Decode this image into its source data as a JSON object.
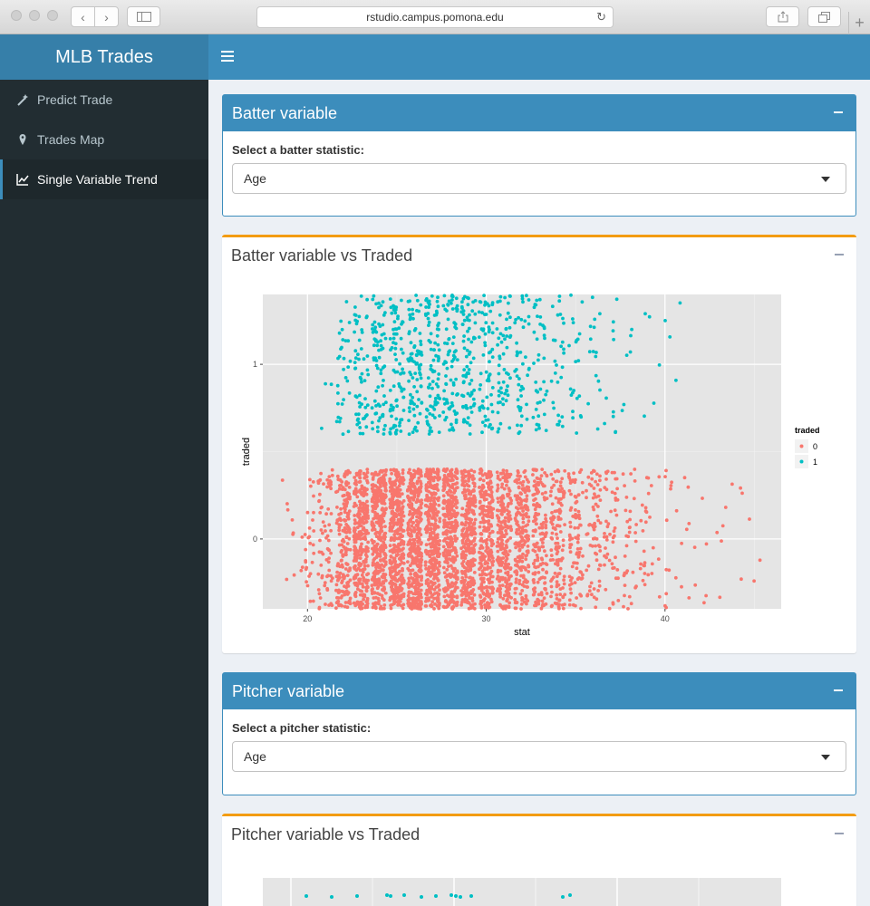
{
  "browser": {
    "url": "rstudio.campus.pomona.edu"
  },
  "app": {
    "title": "MLB Trades"
  },
  "colors": {
    "header": "#3c8dbc",
    "logo_bg": "#367fa9",
    "sidebar_bg": "#222d32",
    "warning": "#f39c12",
    "traded_0": "#f8766d",
    "traded_1": "#00bfc4"
  },
  "sidebar": {
    "items": [
      {
        "label": "Predict Trade",
        "icon": "magic-wand-icon",
        "active": false
      },
      {
        "label": "Trades Map",
        "icon": "map-marker-icon",
        "active": false
      },
      {
        "label": "Single Variable Trend",
        "icon": "line-chart-icon",
        "active": true
      }
    ]
  },
  "batter_box": {
    "title": "Batter variable",
    "label": "Select a batter statistic:",
    "selected": "Age"
  },
  "batter_plot_box": {
    "title": "Batter variable vs Traded"
  },
  "pitcher_box": {
    "title": "Pitcher variable",
    "label": "Select a pitcher statistic:",
    "selected": "Age"
  },
  "pitcher_plot_box": {
    "title": "Pitcher variable vs Traded"
  },
  "chart_data": [
    {
      "type": "scatter",
      "title": "",
      "xlabel": "stat",
      "ylabel": "traded",
      "xlim": [
        17.5,
        46.5
      ],
      "ylim": [
        -0.4,
        1.4
      ],
      "x_ticks": [
        20,
        30,
        40
      ],
      "y_ticks": [
        0,
        1
      ],
      "grid": true,
      "jitter": true,
      "legend": {
        "title": "traded",
        "position": "right",
        "entries": [
          "0",
          "1"
        ]
      },
      "series": [
        {
          "name": "0",
          "y": 0,
          "x_density": [
            {
              "x": 19,
              "n": 8
            },
            {
              "x": 20,
              "n": 30
            },
            {
              "x": 21,
              "n": 70
            },
            {
              "x": 22,
              "n": 180
            },
            {
              "x": 23,
              "n": 300
            },
            {
              "x": 24,
              "n": 340
            },
            {
              "x": 25,
              "n": 360
            },
            {
              "x": 26,
              "n": 360
            },
            {
              "x": 27,
              "n": 350
            },
            {
              "x": 28,
              "n": 330
            },
            {
              "x": 29,
              "n": 300
            },
            {
              "x": 30,
              "n": 270
            },
            {
              "x": 31,
              "n": 230
            },
            {
              "x": 32,
              "n": 200
            },
            {
              "x": 33,
              "n": 160
            },
            {
              "x": 34,
              "n": 130
            },
            {
              "x": 35,
              "n": 90
            },
            {
              "x": 36,
              "n": 70
            },
            {
              "x": 37,
              "n": 50
            },
            {
              "x": 38,
              "n": 35
            },
            {
              "x": 39,
              "n": 25
            },
            {
              "x": 40,
              "n": 14
            },
            {
              "x": 41,
              "n": 9
            },
            {
              "x": 42,
              "n": 6
            },
            {
              "x": 43,
              "n": 5
            },
            {
              "x": 44,
              "n": 4
            },
            {
              "x": 45,
              "n": 3
            }
          ]
        },
        {
          "name": "1",
          "y": 1,
          "x_density": [
            {
              "x": 21,
              "n": 3
            },
            {
              "x": 22,
              "n": 30
            },
            {
              "x": 23,
              "n": 55
            },
            {
              "x": 24,
              "n": 70
            },
            {
              "x": 25,
              "n": 80
            },
            {
              "x": 26,
              "n": 85
            },
            {
              "x": 27,
              "n": 85
            },
            {
              "x": 28,
              "n": 80
            },
            {
              "x": 29,
              "n": 75
            },
            {
              "x": 30,
              "n": 65
            },
            {
              "x": 31,
              "n": 55
            },
            {
              "x": 32,
              "n": 45
            },
            {
              "x": 33,
              "n": 38
            },
            {
              "x": 34,
              "n": 28
            },
            {
              "x": 35,
              "n": 22
            },
            {
              "x": 36,
              "n": 15
            },
            {
              "x": 37,
              "n": 10
            },
            {
              "x": 38,
              "n": 6
            },
            {
              "x": 39,
              "n": 4
            },
            {
              "x": 40,
              "n": 3
            },
            {
              "x": 41,
              "n": 2
            }
          ]
        }
      ]
    }
  ]
}
